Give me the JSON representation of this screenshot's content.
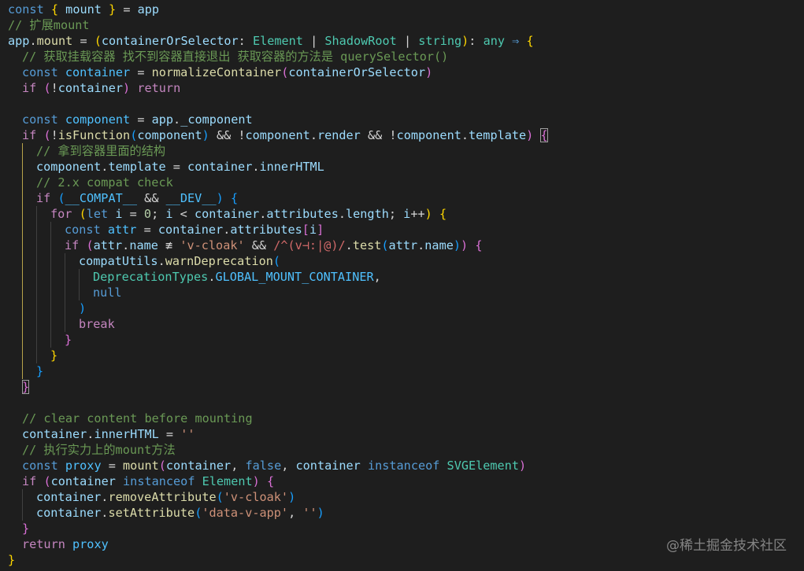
{
  "editor": {
    "theme": {
      "background": "#1e1e1e",
      "indent_guide": "#404040",
      "active_guide": "#b8a44a"
    },
    "lines": [
      {
        "indent": 0,
        "tokens": [
          [
            "kw",
            "const "
          ],
          [
            "b1",
            "{ "
          ],
          [
            "var",
            "mount "
          ],
          [
            "b1",
            "}"
          ],
          [
            "plain",
            " = "
          ],
          [
            "var",
            "app"
          ]
        ]
      },
      {
        "indent": 0,
        "tokens": [
          [
            "cmt",
            "// 扩展mount"
          ]
        ]
      },
      {
        "indent": 0,
        "tokens": [
          [
            "var",
            "app"
          ],
          [
            "plain",
            "."
          ],
          [
            "fn",
            "mount"
          ],
          [
            "plain",
            " = "
          ],
          [
            "b1",
            "("
          ],
          [
            "var",
            "containerOrSelector"
          ],
          [
            "plain",
            ": "
          ],
          [
            "type",
            "Element"
          ],
          [
            "plain",
            " | "
          ],
          [
            "type",
            "ShadowRoot"
          ],
          [
            "plain",
            " | "
          ],
          [
            "type",
            "string"
          ],
          [
            "b1",
            ")"
          ],
          [
            "plain",
            ": "
          ],
          [
            "type",
            "any"
          ],
          [
            "kw",
            " ⇒ "
          ],
          [
            "b1",
            "{"
          ]
        ]
      },
      {
        "indent": 1,
        "tokens": [
          [
            "cmt",
            "// 获取挂载容器 找不到容器直接退出 获取容器的方法是 querySelector()"
          ]
        ]
      },
      {
        "indent": 1,
        "tokens": [
          [
            "kw",
            "const "
          ],
          [
            "const",
            "container"
          ],
          [
            "plain",
            " = "
          ],
          [
            "fn",
            "normalizeContainer"
          ],
          [
            "b2",
            "("
          ],
          [
            "var",
            "containerOrSelector"
          ],
          [
            "b2",
            ")"
          ]
        ]
      },
      {
        "indent": 1,
        "tokens": [
          [
            "ctl",
            "if "
          ],
          [
            "b2",
            "("
          ],
          [
            "plain",
            "!"
          ],
          [
            "var",
            "container"
          ],
          [
            "b2",
            ")"
          ],
          [
            "ctl",
            " return"
          ]
        ]
      },
      {
        "indent": 0,
        "tokens": []
      },
      {
        "indent": 1,
        "tokens": [
          [
            "kw",
            "const "
          ],
          [
            "const",
            "component"
          ],
          [
            "plain",
            " = "
          ],
          [
            "var",
            "app"
          ],
          [
            "plain",
            "."
          ],
          [
            "var",
            "_component"
          ]
        ]
      },
      {
        "indent": 1,
        "tokens": [
          [
            "ctl",
            "if "
          ],
          [
            "b2",
            "("
          ],
          [
            "plain",
            "!"
          ],
          [
            "fn",
            "isFunction"
          ],
          [
            "b3",
            "("
          ],
          [
            "var",
            "component"
          ],
          [
            "b3",
            ")"
          ],
          [
            "plain",
            " && !"
          ],
          [
            "var",
            "component"
          ],
          [
            "plain",
            "."
          ],
          [
            "var",
            "render"
          ],
          [
            "plain",
            " && !"
          ],
          [
            "var",
            "component"
          ],
          [
            "plain",
            "."
          ],
          [
            "var",
            "template"
          ],
          [
            "b2",
            ")"
          ],
          [
            "plain",
            " "
          ],
          [
            "b2m",
            "{"
          ]
        ]
      },
      {
        "indent": 2,
        "tokens": [
          [
            "cmt",
            "// 拿到容器里面的结构"
          ]
        ]
      },
      {
        "indent": 2,
        "tokens": [
          [
            "var",
            "component"
          ],
          [
            "plain",
            "."
          ],
          [
            "var",
            "template"
          ],
          [
            "plain",
            " = "
          ],
          [
            "var",
            "container"
          ],
          [
            "plain",
            "."
          ],
          [
            "var",
            "innerHTML"
          ]
        ]
      },
      {
        "indent": 2,
        "tokens": [
          [
            "cmt",
            "// 2.x compat check"
          ]
        ]
      },
      {
        "indent": 2,
        "tokens": [
          [
            "ctl",
            "if "
          ],
          [
            "b3",
            "("
          ],
          [
            "const",
            "__COMPAT__"
          ],
          [
            "plain",
            " && "
          ],
          [
            "const",
            "__DEV__"
          ],
          [
            "b3",
            ")"
          ],
          [
            "plain",
            " "
          ],
          [
            "b3",
            "{"
          ]
        ]
      },
      {
        "indent": 3,
        "tokens": [
          [
            "ctl",
            "for "
          ],
          [
            "b1",
            "("
          ],
          [
            "kw",
            "let "
          ],
          [
            "var",
            "i"
          ],
          [
            "plain",
            " = "
          ],
          [
            "num",
            "0"
          ],
          [
            "plain",
            "; "
          ],
          [
            "var",
            "i"
          ],
          [
            "plain",
            " < "
          ],
          [
            "var",
            "container"
          ],
          [
            "plain",
            "."
          ],
          [
            "var",
            "attributes"
          ],
          [
            "plain",
            "."
          ],
          [
            "var",
            "length"
          ],
          [
            "plain",
            "; "
          ],
          [
            "var",
            "i"
          ],
          [
            "plain",
            "++"
          ],
          [
            "b1",
            ")"
          ],
          [
            "plain",
            " "
          ],
          [
            "b1",
            "{"
          ]
        ]
      },
      {
        "indent": 4,
        "tokens": [
          [
            "kw",
            "const "
          ],
          [
            "const",
            "attr"
          ],
          [
            "plain",
            " = "
          ],
          [
            "var",
            "container"
          ],
          [
            "plain",
            "."
          ],
          [
            "var",
            "attributes"
          ],
          [
            "b2",
            "["
          ],
          [
            "var",
            "i"
          ],
          [
            "b2",
            "]"
          ]
        ]
      },
      {
        "indent": 4,
        "tokens": [
          [
            "ctl",
            "if "
          ],
          [
            "b2",
            "("
          ],
          [
            "var",
            "attr"
          ],
          [
            "plain",
            "."
          ],
          [
            "var",
            "name"
          ],
          [
            "plain",
            " ≢ "
          ],
          [
            "str",
            "'v-cloak'"
          ],
          [
            "plain",
            " && "
          ],
          [
            "re",
            "/^(v⊣:|@)/"
          ],
          [
            "plain",
            "."
          ],
          [
            "fn",
            "test"
          ],
          [
            "b3",
            "("
          ],
          [
            "var",
            "attr"
          ],
          [
            "plain",
            "."
          ],
          [
            "var",
            "name"
          ],
          [
            "b3",
            ")"
          ],
          [
            "b2",
            ")"
          ],
          [
            "plain",
            " "
          ],
          [
            "b2",
            "{"
          ]
        ]
      },
      {
        "indent": 5,
        "tokens": [
          [
            "var",
            "compatUtils"
          ],
          [
            "plain",
            "."
          ],
          [
            "fn",
            "warnDeprecation"
          ],
          [
            "b3",
            "("
          ]
        ]
      },
      {
        "indent": 6,
        "tokens": [
          [
            "type",
            "DeprecationTypes"
          ],
          [
            "plain",
            "."
          ],
          [
            "const",
            "GLOBAL_MOUNT_CONTAINER"
          ],
          [
            "plain",
            ","
          ]
        ]
      },
      {
        "indent": 6,
        "tokens": [
          [
            "kw",
            "null"
          ]
        ]
      },
      {
        "indent": 5,
        "tokens": [
          [
            "b3",
            ")"
          ]
        ]
      },
      {
        "indent": 5,
        "tokens": [
          [
            "ctl",
            "break"
          ]
        ]
      },
      {
        "indent": 4,
        "tokens": [
          [
            "b2",
            "}"
          ]
        ]
      },
      {
        "indent": 3,
        "tokens": [
          [
            "b1",
            "}"
          ]
        ]
      },
      {
        "indent": 2,
        "tokens": [
          [
            "b3",
            "}"
          ]
        ]
      },
      {
        "indent": 1,
        "tokens": [
          [
            "b2m",
            "}"
          ]
        ]
      },
      {
        "indent": 0,
        "tokens": []
      },
      {
        "indent": 1,
        "tokens": [
          [
            "cmt",
            "// clear content before mounting"
          ]
        ]
      },
      {
        "indent": 1,
        "tokens": [
          [
            "var",
            "container"
          ],
          [
            "plain",
            "."
          ],
          [
            "var",
            "innerHTML"
          ],
          [
            "plain",
            " = "
          ],
          [
            "str",
            "''"
          ]
        ]
      },
      {
        "indent": 1,
        "tokens": [
          [
            "cmt",
            "// 执行实力上的mount方法"
          ]
        ]
      },
      {
        "indent": 1,
        "tokens": [
          [
            "kw",
            "const "
          ],
          [
            "const",
            "proxy"
          ],
          [
            "plain",
            " = "
          ],
          [
            "fn",
            "mount"
          ],
          [
            "b2",
            "("
          ],
          [
            "var",
            "container"
          ],
          [
            "plain",
            ", "
          ],
          [
            "kw",
            "false"
          ],
          [
            "plain",
            ", "
          ],
          [
            "var",
            "container"
          ],
          [
            "kw",
            " instanceof "
          ],
          [
            "type",
            "SVGElement"
          ],
          [
            "b2",
            ")"
          ]
        ]
      },
      {
        "indent": 1,
        "tokens": [
          [
            "ctl",
            "if "
          ],
          [
            "b2",
            "("
          ],
          [
            "var",
            "container"
          ],
          [
            "kw",
            " instanceof "
          ],
          [
            "type",
            "Element"
          ],
          [
            "b2",
            ")"
          ],
          [
            "plain",
            " "
          ],
          [
            "b2",
            "{"
          ]
        ]
      },
      {
        "indent": 2,
        "tokens": [
          [
            "var",
            "container"
          ],
          [
            "plain",
            "."
          ],
          [
            "fn",
            "removeAttribute"
          ],
          [
            "b3",
            "("
          ],
          [
            "str",
            "'v-cloak'"
          ],
          [
            "b3",
            ")"
          ]
        ]
      },
      {
        "indent": 2,
        "tokens": [
          [
            "var",
            "container"
          ],
          [
            "plain",
            "."
          ],
          [
            "fn",
            "setAttribute"
          ],
          [
            "b3",
            "("
          ],
          [
            "str",
            "'data-v-app'"
          ],
          [
            "plain",
            ", "
          ],
          [
            "str",
            "''"
          ],
          [
            "b3",
            ")"
          ]
        ]
      },
      {
        "indent": 1,
        "tokens": [
          [
            "b2",
            "}"
          ]
        ]
      },
      {
        "indent": 1,
        "tokens": [
          [
            "ctl",
            "return "
          ],
          [
            "const",
            "proxy"
          ]
        ]
      },
      {
        "indent": 0,
        "tokens": [
          [
            "b1",
            "}"
          ]
        ]
      }
    ]
  },
  "watermark": "@稀土掘金技术社区"
}
